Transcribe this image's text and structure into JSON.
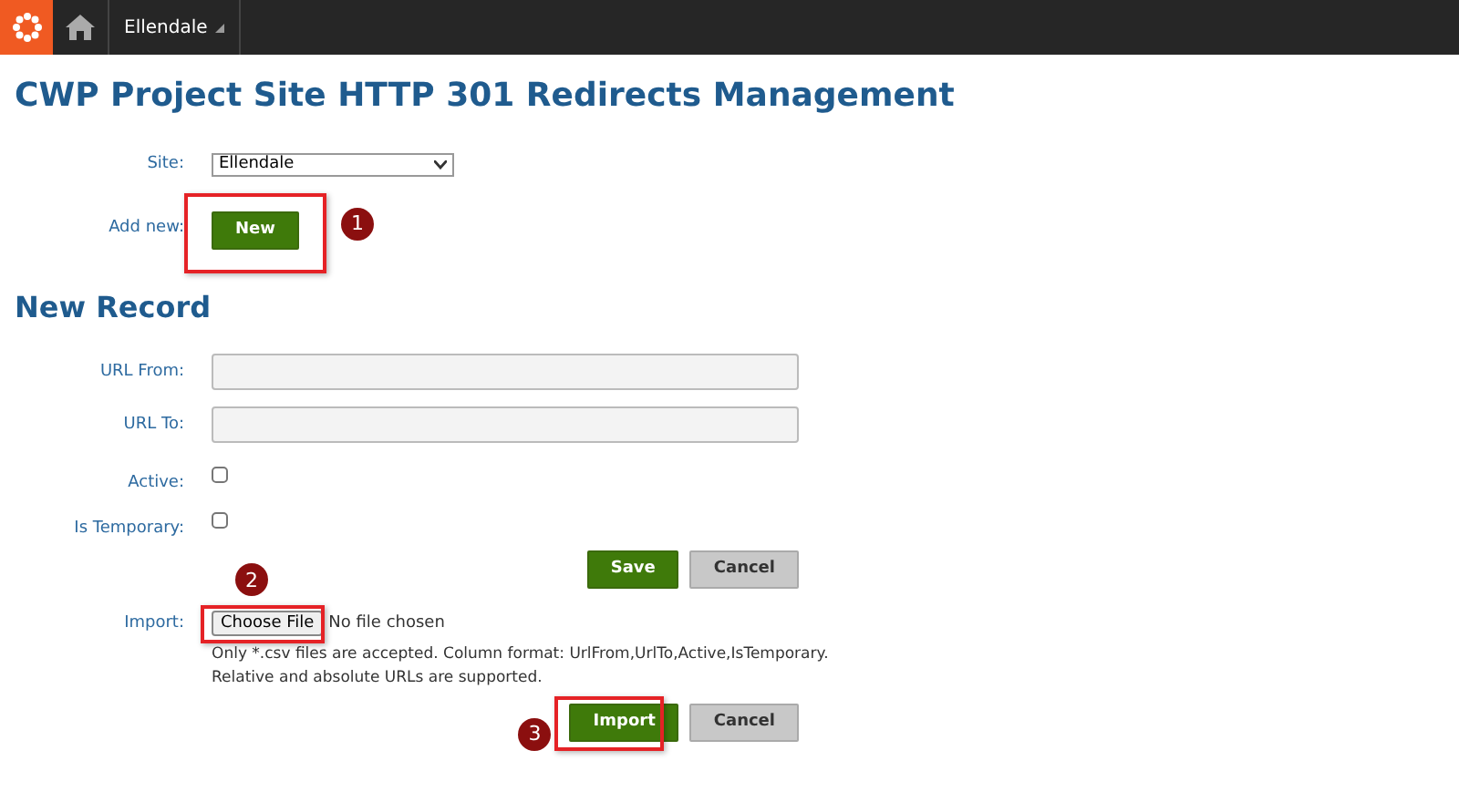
{
  "topbar": {
    "site_menu": "Ellendale"
  },
  "title": "CWP Project Site HTTP 301 Redirects Management",
  "site": {
    "label": "Site:",
    "value": "Ellendale"
  },
  "add_new": {
    "label": "Add new:",
    "button": "New",
    "callout": "1"
  },
  "new_record": {
    "heading": "New Record",
    "fields": [
      {
        "kind": "text",
        "label": "URL From:"
      },
      {
        "kind": "text",
        "label": "URL To:"
      },
      {
        "kind": "checkbox",
        "label": "Active:",
        "checked": false
      },
      {
        "kind": "checkbox",
        "label": "Is Temporary:",
        "checked": false
      }
    ],
    "buttons": [
      "Save",
      "Cancel"
    ]
  },
  "import": {
    "label": "Import:",
    "choose_button": "Choose File",
    "file_status": "No file chosen",
    "callout": "2",
    "help": [
      "Only *.csv files are accepted. Column format: UrlFrom,UrlTo,Active,IsTemporary.",
      "Relative and absolute URLs are supported."
    ],
    "buttons": [
      "Import",
      "Cancel"
    ],
    "callout_import": "3"
  }
}
